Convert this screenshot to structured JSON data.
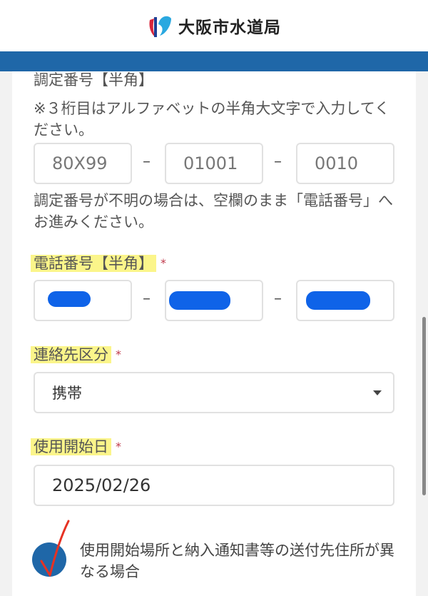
{
  "header": {
    "logo_text": "大阪市水道局"
  },
  "meter_number": {
    "label": "調定番号【半角】",
    "note": "※３桁目はアルファベットの半角大文字で入力してください。",
    "part1": "80X99",
    "part2": "01001",
    "part3": "0010",
    "dash": "–",
    "help": "調定番号が不明の場合は、空欄のまま「電話番号」へお進みください。"
  },
  "phone": {
    "label": "電話番号【半角】",
    "required": "*"
  },
  "contact_type": {
    "label": "連絡先区分",
    "required": "*",
    "value": "携帯"
  },
  "start_date": {
    "label": "使用開始日",
    "required": "*",
    "value": "2025/02/26"
  },
  "different_address": {
    "label": "使用開始場所と納入通知書等の送付先住所が異なる場合"
  },
  "colors": {
    "brand_blue": "#1f67a8",
    "highlight": "#fbf58a",
    "required_red": "#c0394b",
    "redaction": "#0f63e8"
  }
}
